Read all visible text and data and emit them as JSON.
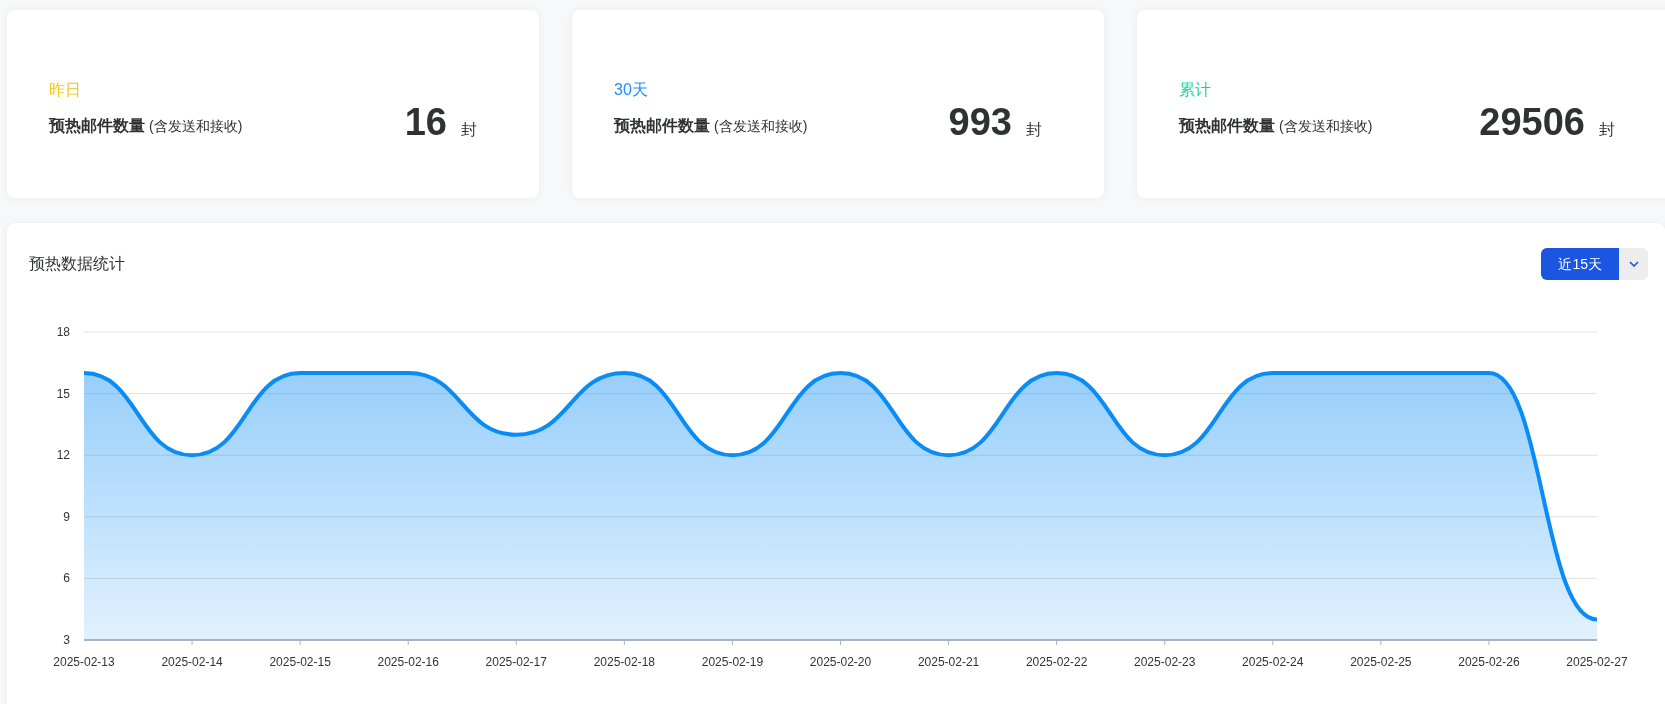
{
  "cards": [
    {
      "period": "昨日",
      "color": "#f5c518",
      "title": "预热邮件数量",
      "note": "(含发送和接收)",
      "value": "16",
      "unit": "封"
    },
    {
      "period": "30天",
      "color": "#1890ff",
      "title": "预热邮件数量",
      "note": "(含发送和接收)",
      "value": "993",
      "unit": "封"
    },
    {
      "period": "累计",
      "color": "#19d39a",
      "title": "预热邮件数量",
      "note": "(含发送和接收)",
      "value": "29506",
      "unit": "封"
    }
  ],
  "panel": {
    "title": "预热数据统计",
    "range_button": "近15天",
    "chart_data": {
      "type": "area",
      "categories": [
        "2025-02-13",
        "2025-02-14",
        "2025-02-15",
        "2025-02-16",
        "2025-02-17",
        "2025-02-18",
        "2025-02-19",
        "2025-02-20",
        "2025-02-21",
        "2025-02-22",
        "2025-02-23",
        "2025-02-24",
        "2025-02-25",
        "2025-02-26",
        "2025-02-27"
      ],
      "series": [
        {
          "color": "#0a8cf5",
          "values": [
            16,
            12,
            16,
            16,
            13,
            16,
            12,
            16,
            12,
            16,
            12,
            16,
            16,
            16,
            4
          ]
        }
      ],
      "grid": true,
      "ylim": [
        3,
        18
      ],
      "yticks": [
        3,
        6,
        9,
        12,
        15,
        18
      ]
    }
  }
}
